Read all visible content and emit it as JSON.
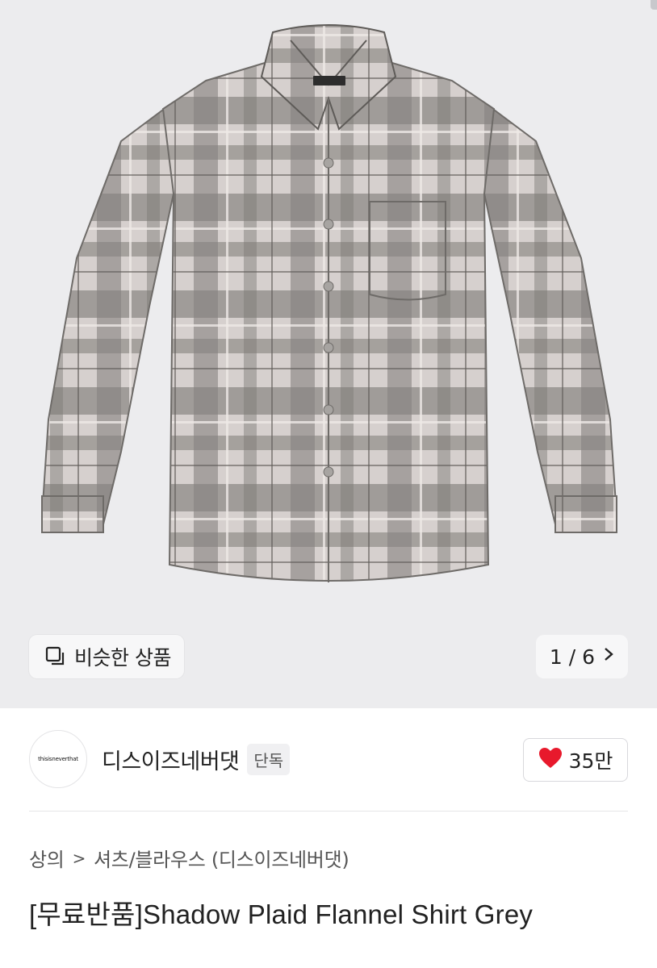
{
  "gallery": {
    "similar_label": "비슷한 상품",
    "similar_icon": "similar-items-icon",
    "counter": "1 / 6",
    "next_icon": "chevron-right-icon",
    "background": "#ececee",
    "product_label_text": "thisisneverthat"
  },
  "brand": {
    "logo_text": "thisisneverthat",
    "name": "디스이즈네버댓",
    "badge": "단독",
    "like_icon": "heart-icon",
    "like_color": "#e8192c",
    "like_count": "35만"
  },
  "breadcrumb": {
    "level1": "상의",
    "separator": ">",
    "level2": "셔츠/블라우스 (디스이즈네버댓)"
  },
  "product": {
    "title": "[무료반품]Shadow Plaid Flannel Shirt Grey"
  }
}
